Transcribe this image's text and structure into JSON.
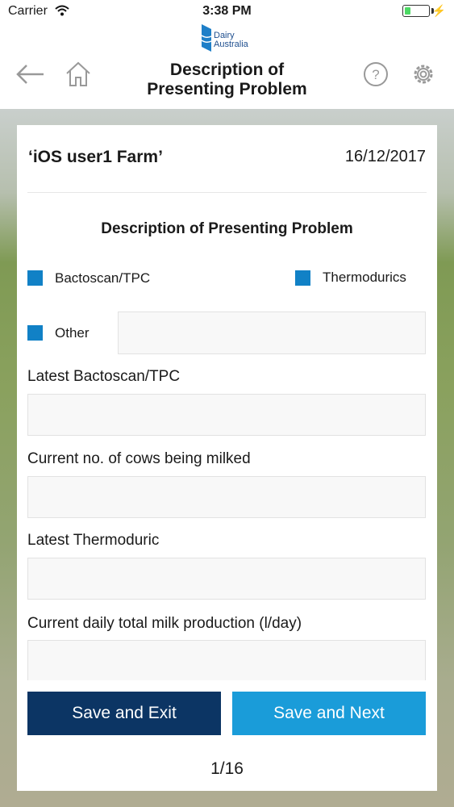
{
  "status_bar": {
    "carrier": "Carrier",
    "time": "3:38 PM",
    "battery_level": 0.25
  },
  "header": {
    "logo_line1": "Dairy",
    "logo_line2": "Australia",
    "title_line1": "Description of",
    "title_line2": "Presenting Problem"
  },
  "card": {
    "farm_name": "‘iOS user1 Farm’",
    "date": "16/12/2017",
    "section_title": "Description of Presenting Problem",
    "checkboxes": [
      {
        "label": "Bactoscan/TPC"
      },
      {
        "label": "Thermodurics"
      },
      {
        "label": "Other"
      }
    ],
    "other_value": "",
    "fields": [
      {
        "label": "Latest Bactoscan/TPC",
        "value": ""
      },
      {
        "label": "Current no. of cows being milked",
        "value": ""
      },
      {
        "label": "Latest Thermoduric",
        "value": ""
      },
      {
        "label": "Current daily total milk production (l/day)",
        "value": ""
      }
    ],
    "save_exit_label": "Save and Exit",
    "save_next_label": "Save and Next",
    "pager": "1/16"
  },
  "colors": {
    "checkbox": "#1181c6",
    "save_exit": "#0c3564",
    "save_next": "#1a9cd9",
    "logo": "#1f4f8f"
  }
}
